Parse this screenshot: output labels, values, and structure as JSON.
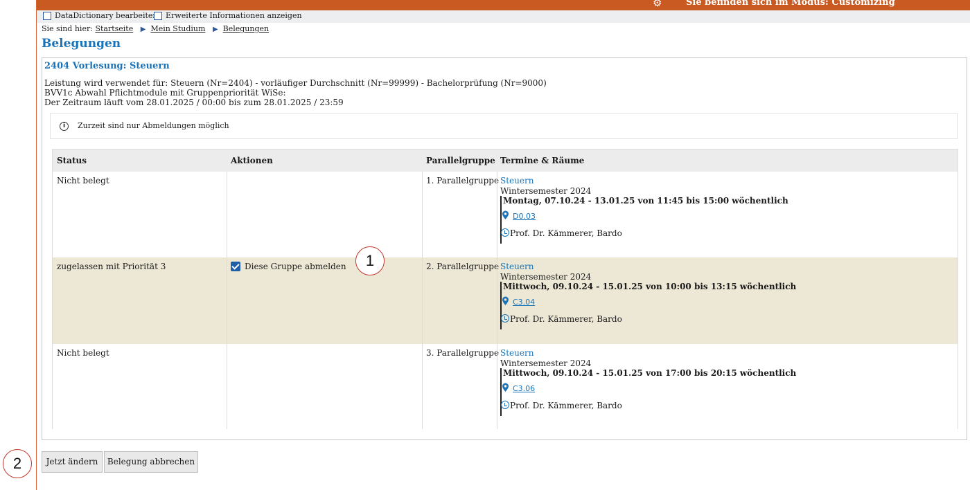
{
  "topbar": {
    "gear_icon": "gear-icon",
    "mode_text": "Sie befinden sich im Modus: Customizing"
  },
  "options": {
    "data_dictionary": "DataDictionary bearbeiten",
    "extended_info": "Erweiterte Informationen anzeigen"
  },
  "breadcrumb": {
    "prefix": "Sie sind hier:",
    "items": [
      "Startseite",
      "Mein Studium",
      "Belegungen"
    ]
  },
  "page_title": "Belegungen",
  "panel": {
    "title": "2404 Vorlesung: Steuern",
    "info_lines": [
      "Leistung wird verwendet für: Steuern (Nr=2404) - vorläufiger Durchschnitt (Nr=99999) - Bachelorprüfung (Nr=9000)",
      "BVV1c Abwahl Pflichtmodule mit Gruppenpriorität WiSe:",
      "Der Zeitraum läuft vom 28.01.2025 / 00:00 bis zum 28.01.2025 / 23:59"
    ],
    "notice": "Zurzeit sind nur Abmeldungen möglich",
    "notice_icon": "info-icon"
  },
  "table": {
    "headers": [
      "Status",
      "Aktionen",
      "Parallelgruppe",
      "Termine & Räume"
    ],
    "rows": [
      {
        "status": "Nicht belegt",
        "action": "",
        "group": "1. Parallelgruppe",
        "course": "Steuern",
        "semester": "Wintersemester 2024",
        "when": "Montag, 07.10.24 - 13.01.25 von 11:45 bis 15:00 wöchentlich",
        "room": "D0.03",
        "lecturer": "Prof. Dr. Kämmerer, Bardo"
      },
      {
        "status": "zugelassen mit Priorität 3",
        "action": "Diese Gruppe abmelden",
        "action_checked": true,
        "group": "2. Parallelgruppe",
        "course": "Steuern",
        "semester": "Wintersemester 2024",
        "when": "Mittwoch, 09.10.24 - 15.01.25 von 10:00 bis 13:15 wöchentlich",
        "room": "C3.04",
        "lecturer": "Prof. Dr. Kämmerer, Bardo"
      },
      {
        "status": "Nicht belegt",
        "action": "",
        "group": "3. Parallelgruppe",
        "course": "Steuern",
        "semester": "Wintersemester 2024",
        "when": "Mittwoch, 09.10.24 - 15.01.25 von 17:00 bis 20:15 wöchentlich",
        "room": "C3.06",
        "lecturer": "Prof. Dr. Kämmerer, Bardo"
      }
    ]
  },
  "buttons": {
    "change": "Jetzt ändern",
    "cancel": "Belegung abbrechen"
  },
  "callouts": [
    "1",
    "2"
  ],
  "colors": {
    "accent_orange": "#c95a22",
    "link_blue": "#1a73b8",
    "highlight_row": "#ede8d6"
  }
}
